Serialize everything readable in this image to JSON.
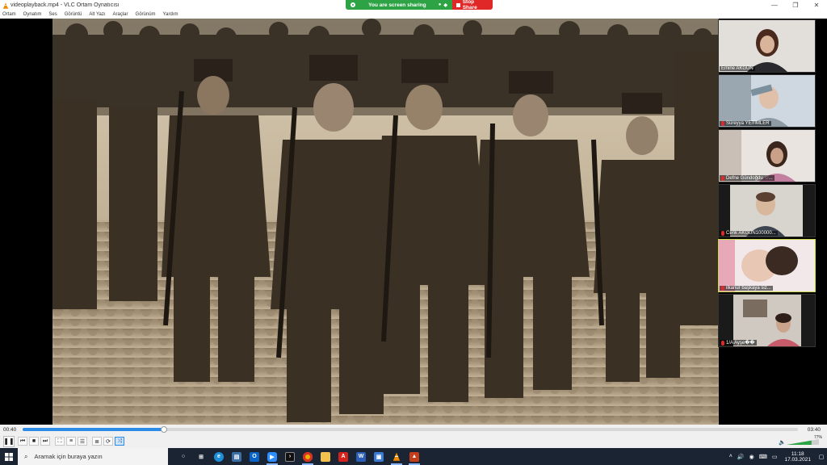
{
  "window": {
    "title": "videoplayback.mp4 - VLC Ortam Oynatıcısı",
    "controls": {
      "minimize": "—",
      "maximize": "❐",
      "close": "✕"
    }
  },
  "menu": [
    "Ortam",
    "Oynatım",
    "Ses",
    "Görüntü",
    "Alt Yazı",
    "Araçlar",
    "Görünüm",
    "Yardım"
  ],
  "share_banner": {
    "status": "You are screen sharing",
    "stop_label": "Stop Share",
    "colors": {
      "sharing": "#2da345",
      "stop": "#e02828"
    }
  },
  "participants": [
    {
      "name": "Emine AKGÜN",
      "muted": false
    },
    {
      "name": "Süreyya YETİMLER",
      "muted": true
    },
    {
      "name": "Defne Gündoğdu ♡...",
      "muted": true
    },
    {
      "name": "Cenk AKGÜN100000...",
      "muted": true
    },
    {
      "name": "ilkanur başkaya siz...",
      "muted": true
    },
    {
      "name": "1/A Ayşe��",
      "muted": true
    }
  ],
  "player": {
    "time_elapsed": "00:40",
    "time_total": "03:40",
    "progress_fraction": 0.182,
    "volume": "77%",
    "volume_fraction": 0.77,
    "accent": "#2b8be6"
  },
  "taskbar": {
    "search_placeholder": "Aramak için buraya yazın",
    "clock_time": "11:18",
    "clock_date": "17.03.2021"
  }
}
